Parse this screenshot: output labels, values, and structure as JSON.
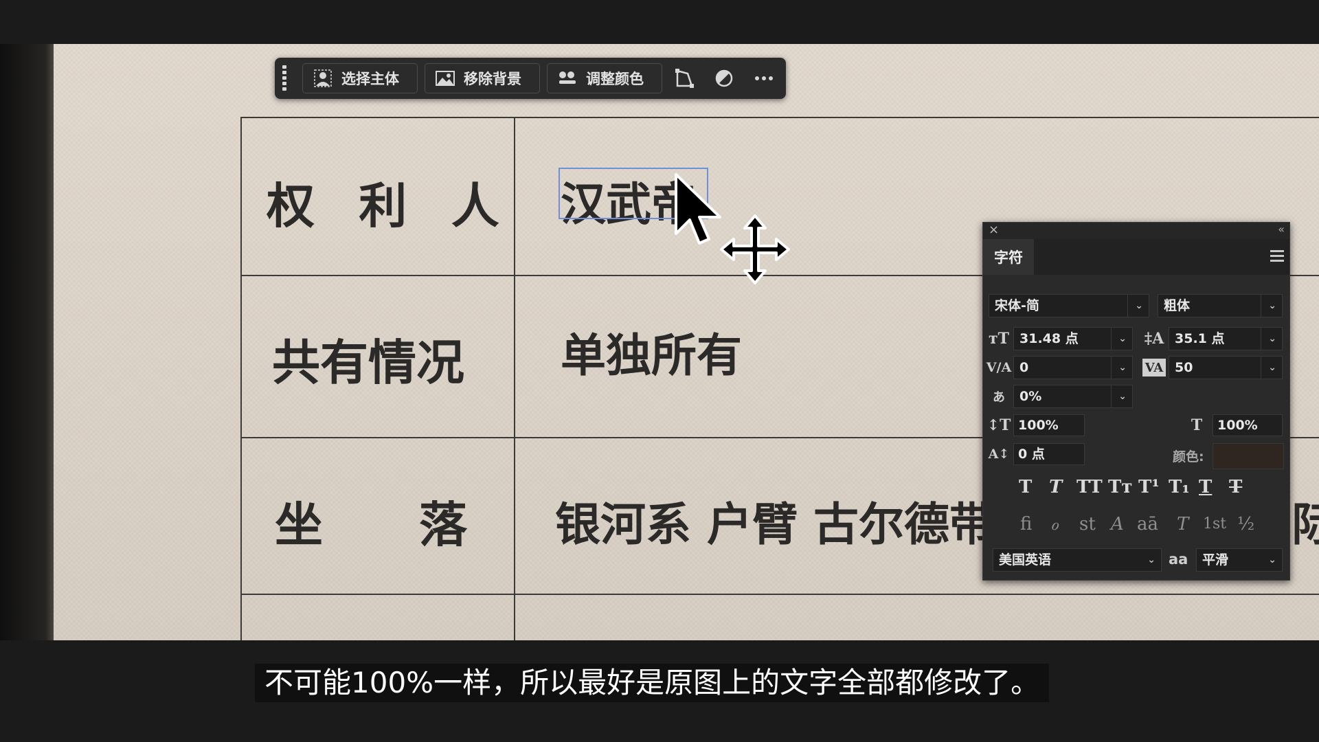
{
  "toolbar": {
    "buttons": [
      {
        "label": "选择主体",
        "icon": "person-icon"
      },
      {
        "label": "移除背景",
        "icon": "image-icon"
      },
      {
        "label": "调整颜色",
        "icon": "adjust-icon"
      }
    ],
    "icons": [
      "transform-icon",
      "contrast-icon",
      "more-icon"
    ]
  },
  "document": {
    "rows": [
      {
        "label": "权 利 人",
        "value": "汉武帝"
      },
      {
        "label": "共有情况",
        "value": "单独所有"
      },
      {
        "label": "坐　　落",
        "value": "银河系 户臂 古尔德带"
      }
    ],
    "right_fragment": "际"
  },
  "character_panel": {
    "tab": "字符",
    "font_family": "宋体-简",
    "font_style": "粗体",
    "font_size": "31.48 点",
    "leading": "35.1 点",
    "kerning": "0",
    "tracking": "50",
    "tsume": "0%",
    "vertical_scale": "100%",
    "horizontal_scale": "100%",
    "baseline_shift": "0 点",
    "color_label": "颜色:",
    "color": "#2f2622",
    "language": "美国英语",
    "antialias_icon": "aa",
    "antialias": "平滑",
    "style_buttons": [
      "T",
      "T",
      "TT",
      "Tт",
      "T¹",
      "T₁",
      "T",
      "T"
    ],
    "opentype_buttons": [
      "ﬁ",
      "ℴ",
      "st",
      "A",
      "aā",
      "T",
      "1st",
      "½"
    ]
  },
  "subtitle": "不可能100%一样，所以最好是原图上的文字全部都修改了。"
}
